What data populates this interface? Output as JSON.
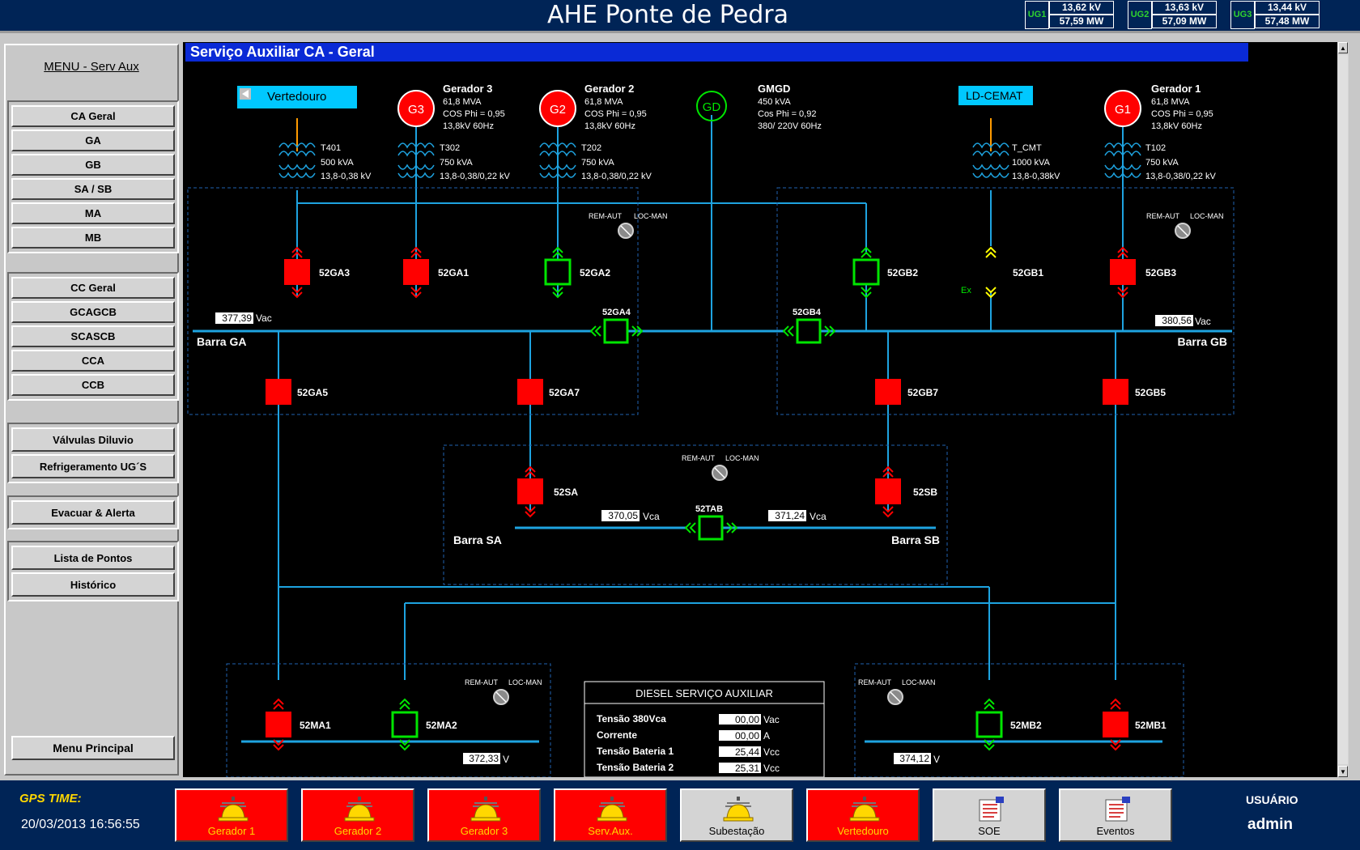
{
  "header": {
    "title": "AHE Ponte de Pedra",
    "units": [
      {
        "name": "UG1",
        "kv": "13,62  kV",
        "mw": "57,59  MW"
      },
      {
        "name": "UG2",
        "kv": "13,63  kV",
        "mw": "57,09  MW"
      },
      {
        "name": "UG3",
        "kv": "13,44  kV",
        "mw": "57,48  MW"
      }
    ]
  },
  "sidebar": {
    "title": "MENU - Serv Aux",
    "group1": [
      "CA Geral",
      "GA",
      "GB",
      "SA / SB",
      "MA",
      "MB"
    ],
    "group2": [
      "CC Geral",
      "GCAGCB",
      "SCASCB",
      "CCA",
      "CCB"
    ],
    "group3": [
      "Válvulas Diluvio",
      "Refrigeramento UG´S"
    ],
    "group4": [
      "Evacuar & Alerta"
    ],
    "group5": [
      "Lista de Pontos",
      "Histórico"
    ],
    "menu_principal": "Menu Principal"
  },
  "diagram": {
    "title": "Serviço Auxiliar CA - Geral",
    "sources": {
      "vertedouro": "Vertedouro",
      "ld_cemat": "LD-CEMAT",
      "g3_symbol": "G3",
      "g2_symbol": "G2",
      "gd_symbol": "GD",
      "g1_symbol": "G1"
    },
    "generators": {
      "g3": [
        "Gerador 3",
        "61,8 MVA",
        "COS Phi = 0,95",
        "13,8kV 60Hz"
      ],
      "g2": [
        "Gerador 2",
        "61,8 MVA",
        "COS Phi = 0,95",
        "13,8kV 60Hz"
      ],
      "gmgd": [
        "GMGD",
        "450 kVA",
        "Cos Phi = 0,92",
        "380/ 220V 60Hz"
      ],
      "g1": [
        "Gerador 1",
        "61,8 MVA",
        "COS Phi = 0,95",
        "13,8kV 60Hz"
      ]
    },
    "transformers": {
      "t401": [
        "T401",
        "500 kVA",
        "13,8-0,38 kV"
      ],
      "t302": [
        "T302",
        "750 kVA",
        "13,8-0,38/0,22 kV"
      ],
      "t202": [
        "T202",
        "750 kVA",
        "13,8-0,38/0,22 kV"
      ],
      "t_cmt": [
        "T_CMT",
        "1000 kVA",
        "13,8-0,38kV"
      ],
      "t102": [
        "T102",
        "750 kVA",
        "13,8-0,38/0,22 kV"
      ]
    },
    "rem_aut": "REM-AUT",
    "loc_man": "LOC-MAN",
    "ex_label": "Ex",
    "breakers": {
      "52GA3": "52GA3",
      "52GA1": "52GA1",
      "52GA2": "52GA2",
      "52GB2": "52GB2",
      "52GB1": "52GB1",
      "52GB3": "52GB3",
      "52GA4": "52GA4",
      "52GB4": "52GB4",
      "52GA5": "52GA5",
      "52GA7": "52GA7",
      "52GB7": "52GB7",
      "52GB5": "52GB5",
      "52SA": "52SA",
      "52SB": "52SB",
      "52TAB": "52TAB",
      "52MA1": "52MA1",
      "52MA2": "52MA2",
      "52MB2": "52MB2",
      "52MB1": "52MB1"
    },
    "bars": {
      "ga": "Barra GA",
      "gb": "Barra GB",
      "sa": "Barra SA",
      "sb": "Barra SB"
    },
    "measurements": {
      "ga_value": "377,39",
      "ga_unit": "Vac",
      "gb_value": "380,56",
      "gb_unit": "Vac",
      "sa_value": "370,05",
      "sa_unit": "Vca",
      "sb_value": "371,24",
      "sb_unit": "Vca",
      "ma_value": "372,33",
      "ma_unit": "V",
      "mb_value": "374,12",
      "mb_unit": "V"
    },
    "diesel": {
      "title": "DIESEL SERVIÇO AUXILIAR",
      "rows": [
        {
          "label": "Tensão 380Vca",
          "value": "00,00",
          "unit": "Vac"
        },
        {
          "label": "Corrente",
          "value": "00,00",
          "unit": "A"
        },
        {
          "label": "Tensão Bateria 1",
          "value": "25,44",
          "unit": "Vcc"
        },
        {
          "label": "Tensão Bateria 2",
          "value": "25,31",
          "unit": "Vcc"
        }
      ]
    },
    "colors": {
      "line": "#1ea3e0",
      "breaker_closed": "#ff0000",
      "breaker_open": "#00e600",
      "alarm_red": "#ff0000",
      "title_bar": "#0a2ad6",
      "source_box": "#00c8ff"
    }
  },
  "footer": {
    "gps_label": "GPS TIME:",
    "gps_time": "20/03/2013 16:56:55",
    "buttons": [
      {
        "label": "Gerador 1",
        "icon": "alarm-bell-icon",
        "state": "alarm"
      },
      {
        "label": "Gerador 2",
        "icon": "alarm-bell-icon",
        "state": "alarm"
      },
      {
        "label": "Gerador 3",
        "icon": "alarm-bell-icon",
        "state": "alarm"
      },
      {
        "label": "Serv.Aux.",
        "icon": "alarm-bell-icon",
        "state": "alarm"
      },
      {
        "label": "Subestação",
        "icon": "alarm-bell-icon",
        "state": "normal"
      },
      {
        "label": "Vertedouro",
        "icon": "alarm-bell-icon",
        "state": "alarm"
      },
      {
        "label": "SOE",
        "icon": "event-list-icon",
        "state": "normal"
      },
      {
        "label": "Eventos",
        "icon": "event-list-icon",
        "state": "normal"
      }
    ],
    "user_label": "USUÁRIO",
    "user_name": "admin"
  }
}
